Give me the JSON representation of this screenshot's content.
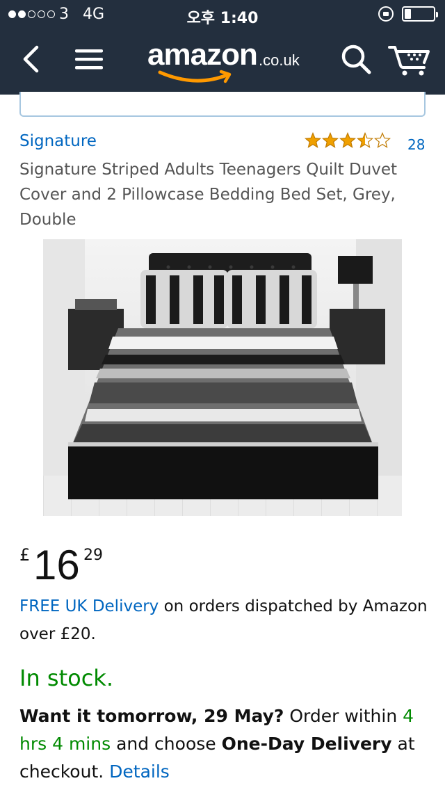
{
  "status_bar": {
    "carrier": "3",
    "network": "4G",
    "time": "오후 1:40"
  },
  "nav": {
    "logo_text": "amazon",
    "logo_tld": ".co.uk",
    "icons": [
      "back-icon",
      "menu-icon",
      "search-icon",
      "cart-icon"
    ]
  },
  "product": {
    "brand": "Signature",
    "rating_stars": 3.5,
    "rating_count": "28",
    "title": "Signature Striped Adults Teenagers Quilt Duvet Cover and 2 Pillowcase Bedding Bed Set, Grey, Double",
    "price": {
      "currency": "£",
      "whole": "16",
      "fraction": "29"
    },
    "delivery": {
      "link_text": "FREE UK Delivery",
      "rest_text": " on orders dispatched by Amazon over £20."
    },
    "stock": "In stock.",
    "want_it": {
      "bold_1": "Want it tomorrow, 29 May?",
      "text_1": " Order within ",
      "countdown": "4 hrs 4 mins",
      "text_2": " and choose ",
      "bold_2": "One-Day Delivery",
      "text_3": " at checkout. ",
      "details_link": "Details"
    }
  },
  "colors": {
    "header_bg": "#232f3e",
    "link": "#0066c0",
    "in_stock": "#008a00",
    "star": "#f0a000",
    "logo_smile": "#ff9900"
  }
}
